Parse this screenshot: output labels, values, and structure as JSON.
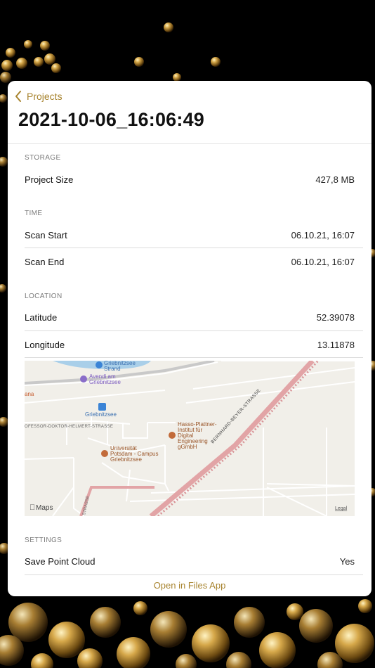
{
  "nav": {
    "back_label": "Projects"
  },
  "title": "2021-10-06_16:06:49",
  "storage": {
    "header": "STORAGE",
    "project_size_label": "Project Size",
    "project_size_value": "427,8 MB"
  },
  "time": {
    "header": "TIME",
    "scan_start_label": "Scan Start",
    "scan_start_value": "06.10.21, 16:07",
    "scan_end_label": "Scan End",
    "scan_end_value": "06.10.21, 16:07"
  },
  "location": {
    "header": "LOCATION",
    "latitude_label": "Latitude",
    "latitude_value": "52.39078",
    "longitude_label": "Longitude",
    "longitude_value": "13.11878"
  },
  "map": {
    "label_strand": "Griebnitzsee Strand",
    "label_strand_1": "Griebnitzsee",
    "label_strand_2": "Strand",
    "label_avendi_1": "Avendi am",
    "label_avendi_2": "Griebnitzsee",
    "label_ana": "ana",
    "label_station": "Griebnitzsee",
    "label_helmert": "OFESSOR-DOKTOR-HELMERT-STRASSE",
    "label_hpi_1": "Hasso-Plattner-",
    "label_hpi_2": "Institut für",
    "label_hpi_3": "Digital",
    "label_hpi_4": "Engineering",
    "label_hpi_5": "gGmbH",
    "label_uni_1": "Universität",
    "label_uni_2": "Potsdam - Campus",
    "label_uni_3": "Griebnitzsee",
    "label_beyer": "BERNHARD-BEYER-STRASSE",
    "label_strasse_left": "STRASSE",
    "attribution": "Maps",
    "legal": "Legal"
  },
  "settings": {
    "header": "SETTINGS",
    "save_point_cloud_label": "Save Point Cloud",
    "save_point_cloud_value": "Yes"
  },
  "footer": {
    "open_files_label": "Open in Files App"
  },
  "colors": {
    "accent": "#a8842f",
    "map_road_pink": "#e2a4a6",
    "map_water": "#a9cfe9",
    "map_poi_purple": "#8a6dc9",
    "map_poi_brown": "#c26b3a",
    "map_station_blue": "#3b84d6"
  }
}
